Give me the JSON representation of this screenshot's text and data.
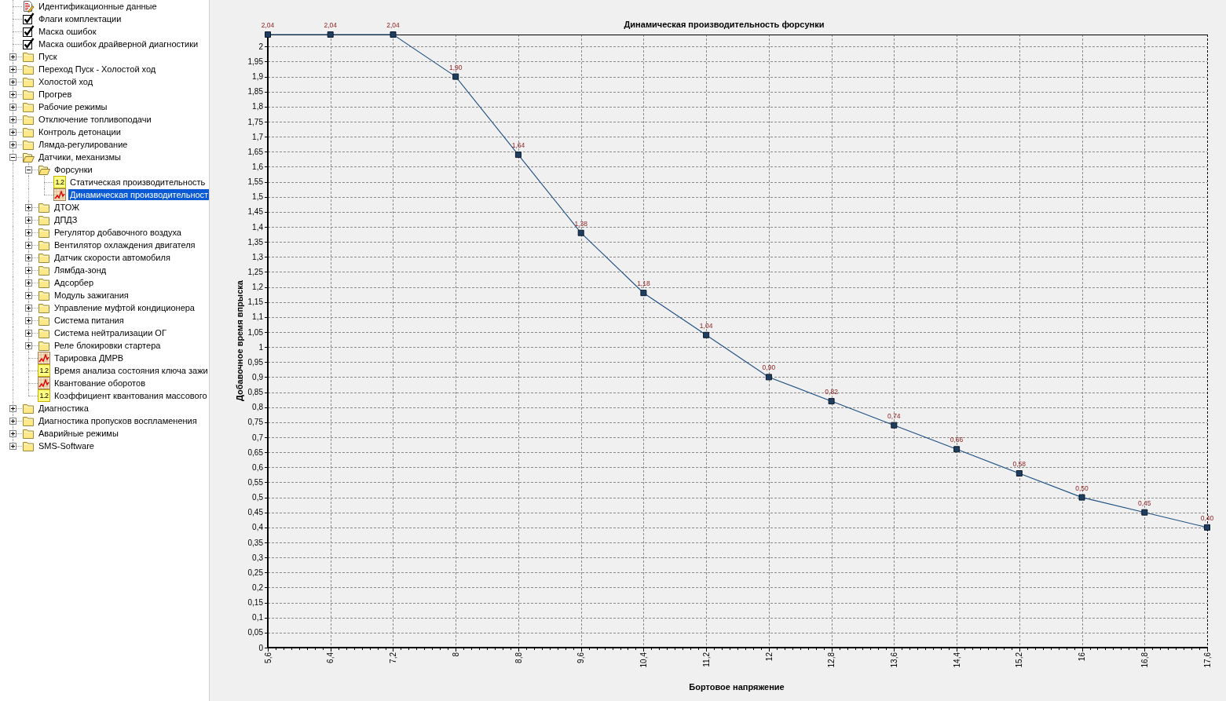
{
  "tree": {
    "items": [
      {
        "label": "Идентификационные данные",
        "kind": "document",
        "selected": false
      },
      {
        "label": "Флаги комплектации",
        "kind": "checklist",
        "selected": false
      },
      {
        "label": "Маска ошибок",
        "kind": "checklist",
        "selected": false
      },
      {
        "label": "Маска ошибок драйверной диагностики",
        "kind": "checklist",
        "selected": false
      },
      {
        "label": "Пуск",
        "kind": "folder",
        "expanded": false,
        "selected": false
      },
      {
        "label": "Переход Пуск - Холостой ход",
        "kind": "folder",
        "expanded": false,
        "selected": false
      },
      {
        "label": "Холостой ход",
        "kind": "folder",
        "expanded": false,
        "selected": false
      },
      {
        "label": "Прогрев",
        "kind": "folder",
        "expanded": false,
        "selected": false
      },
      {
        "label": "Рабочие режимы",
        "kind": "folder",
        "expanded": false,
        "selected": false
      },
      {
        "label": "Отключение топливоподачи",
        "kind": "folder",
        "expanded": false,
        "selected": false
      },
      {
        "label": "Контроль детонации",
        "kind": "folder",
        "expanded": false,
        "selected": false
      },
      {
        "label": "Лямда-регулирование",
        "kind": "folder",
        "expanded": false,
        "selected": false
      },
      {
        "label": "Датчики, механизмы",
        "kind": "folder",
        "expanded": true,
        "selected": false,
        "children": [
          {
            "label": "Форсунки",
            "kind": "folder",
            "expanded": true,
            "selected": false,
            "children": [
              {
                "label": "Статическая производительность",
                "kind": "value",
                "badge": "1.2",
                "selected": false
              },
              {
                "label": "Динамическая производительност",
                "kind": "chart",
                "selected": true
              }
            ]
          },
          {
            "label": "ДТОЖ",
            "kind": "folder",
            "expanded": false,
            "selected": false
          },
          {
            "label": "ДПДЗ",
            "kind": "folder",
            "expanded": false,
            "selected": false
          },
          {
            "label": "Регулятор добавочного воздуха",
            "kind": "folder",
            "expanded": false,
            "selected": false
          },
          {
            "label": "Вентилятор охлаждения двигателя",
            "kind": "folder",
            "expanded": false,
            "selected": false
          },
          {
            "label": "Датчик скорости автомобиля",
            "kind": "folder",
            "expanded": false,
            "selected": false
          },
          {
            "label": "Лямбда-зонд",
            "kind": "folder",
            "expanded": false,
            "selected": false
          },
          {
            "label": "Адсорбер",
            "kind": "folder",
            "expanded": false,
            "selected": false
          },
          {
            "label": "Модуль зажигания",
            "kind": "folder",
            "expanded": false,
            "selected": false
          },
          {
            "label": "Управление муфтой кондиционера",
            "kind": "folder",
            "expanded": false,
            "selected": false
          },
          {
            "label": "Система питания",
            "kind": "folder",
            "expanded": false,
            "selected": false
          },
          {
            "label": "Система нейтрализации ОГ",
            "kind": "folder",
            "expanded": false,
            "selected": false
          },
          {
            "label": "Реле блокировки стартера",
            "kind": "folder",
            "expanded": false,
            "selected": false
          },
          {
            "label": "Тарировка ДМРВ",
            "kind": "chart",
            "selected": false
          },
          {
            "label": "Время анализа состояния ключа зажи",
            "kind": "value",
            "badge": "1.2",
            "selected": false
          },
          {
            "label": "Квантование оборотов",
            "kind": "chart",
            "selected": false
          },
          {
            "label": "Коэффициент квантования массового",
            "kind": "value",
            "badge": "1.2",
            "selected": false
          }
        ]
      },
      {
        "label": "Диагностика",
        "kind": "folder",
        "expanded": false,
        "selected": false
      },
      {
        "label": "Диагностика пропусков воспламенения",
        "kind": "folder",
        "expanded": false,
        "selected": false
      },
      {
        "label": "Аварийные режимы",
        "kind": "folder",
        "expanded": false,
        "selected": false
      },
      {
        "label": "SMS-Software",
        "kind": "folder",
        "expanded": false,
        "selected": false
      }
    ]
  },
  "chart": {
    "chart_data": {
      "type": "line",
      "title": "Динамическая производительность форсунки",
      "xlabel": "Бортовое напряжение",
      "ylabel": "Добавочное время впрыска",
      "x": [
        5.6,
        6.4,
        7.2,
        8,
        8.8,
        9.6,
        10.4,
        11.2,
        12,
        12.8,
        13.6,
        14.4,
        15.2,
        16,
        16.8,
        17.6
      ],
      "values": [
        2.04,
        2.04,
        2.04,
        1.9,
        1.64,
        1.38,
        1.18,
        1.04,
        0.9,
        0.82,
        0.74,
        0.66,
        0.58,
        0.5,
        0.45,
        0.4
      ],
      "value_labels": [
        "2,04",
        "2,04",
        "2,04",
        "1,90",
        "1,64",
        "1,38",
        "1,18",
        "1,04",
        "0,90",
        "0,82",
        "0,74",
        "0,66",
        "0,58",
        "0,50",
        "0,45",
        "0,40"
      ],
      "marker": "square",
      "xlim": [
        5.6,
        17.6
      ],
      "ylim": [
        0,
        2.04
      ],
      "grid": true,
      "xticks": [
        {
          "value": 5.6,
          "label": "5,6"
        },
        {
          "value": 6.4,
          "label": "6,4"
        },
        {
          "value": 7.2,
          "label": "7,2"
        },
        {
          "value": 8,
          "label": "8"
        },
        {
          "value": 8.8,
          "label": "8,8"
        },
        {
          "value": 9.6,
          "label": "9,6"
        },
        {
          "value": 10.4,
          "label": "10,4"
        },
        {
          "value": 11.2,
          "label": "11,2"
        },
        {
          "value": 12,
          "label": "12"
        },
        {
          "value": 12.8,
          "label": "12,8"
        },
        {
          "value": 13.6,
          "label": "13,6"
        },
        {
          "value": 14.4,
          "label": "14,4"
        },
        {
          "value": 15.2,
          "label": "15,2"
        },
        {
          "value": 16,
          "label": "16"
        },
        {
          "value": 16.8,
          "label": "16,8"
        },
        {
          "value": 17.6,
          "label": "17,6"
        }
      ],
      "yticks": [
        {
          "value": 0,
          "label": "0"
        },
        {
          "value": 0.05,
          "label": "0,05"
        },
        {
          "value": 0.1,
          "label": "0,1"
        },
        {
          "value": 0.15,
          "label": "0,15"
        },
        {
          "value": 0.2,
          "label": "0,2"
        },
        {
          "value": 0.25,
          "label": "0,25"
        },
        {
          "value": 0.3,
          "label": "0,3"
        },
        {
          "value": 0.35,
          "label": "0,35"
        },
        {
          "value": 0.4,
          "label": "0,4"
        },
        {
          "value": 0.45,
          "label": "0,45"
        },
        {
          "value": 0.5,
          "label": "0,5"
        },
        {
          "value": 0.55,
          "label": "0,55"
        },
        {
          "value": 0.6,
          "label": "0,6"
        },
        {
          "value": 0.65,
          "label": "0,65"
        },
        {
          "value": 0.7,
          "label": "0,7"
        },
        {
          "value": 0.75,
          "label": "0,75"
        },
        {
          "value": 0.8,
          "label": "0,8"
        },
        {
          "value": 0.85,
          "label": "0,85"
        },
        {
          "value": 0.9,
          "label": "0,9"
        },
        {
          "value": 0.95,
          "label": "0,95"
        },
        {
          "value": 1,
          "label": "1"
        },
        {
          "value": 1.05,
          "label": "1,05"
        },
        {
          "value": 1.1,
          "label": "1,1"
        },
        {
          "value": 1.15,
          "label": "1,15"
        },
        {
          "value": 1.2,
          "label": "1,2"
        },
        {
          "value": 1.25,
          "label": "1,25"
        },
        {
          "value": 1.3,
          "label": "1,3"
        },
        {
          "value": 1.35,
          "label": "1,35"
        },
        {
          "value": 1.4,
          "label": "1,4"
        },
        {
          "value": 1.45,
          "label": "1,45"
        },
        {
          "value": 1.5,
          "label": "1,5"
        },
        {
          "value": 1.55,
          "label": "1,55"
        },
        {
          "value": 1.6,
          "label": "1,6"
        },
        {
          "value": 1.65,
          "label": "1,65"
        },
        {
          "value": 1.7,
          "label": "1,7"
        },
        {
          "value": 1.75,
          "label": "1,75"
        },
        {
          "value": 1.8,
          "label": "1,8"
        },
        {
          "value": 1.85,
          "label": "1,85"
        },
        {
          "value": 1.9,
          "label": "1,9"
        },
        {
          "value": 1.95,
          "label": "1,95"
        },
        {
          "value": 2,
          "label": "2"
        }
      ]
    }
  }
}
